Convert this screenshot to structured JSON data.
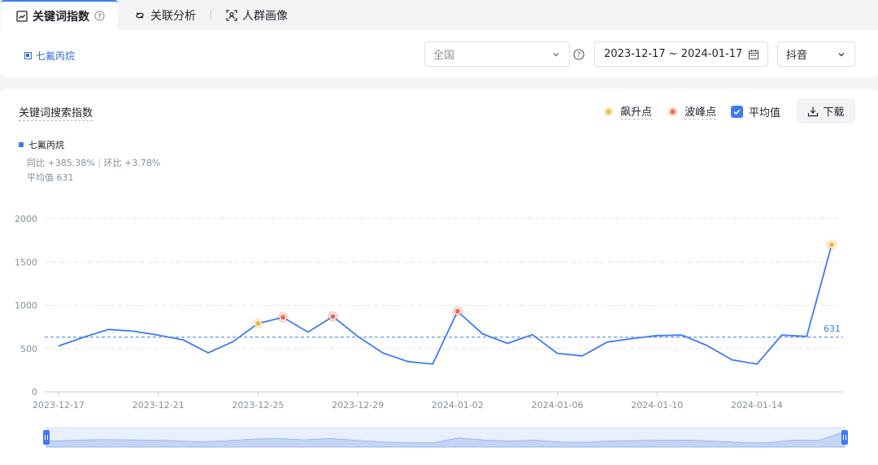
{
  "tabs": [
    {
      "label": "关键词指数",
      "icon": "trend-chart-icon",
      "active": true
    },
    {
      "label": "关联分析",
      "icon": "link-icon",
      "active": false
    },
    {
      "label": "人群画像",
      "icon": "user-scan-icon",
      "active": false
    }
  ],
  "filter": {
    "keyword": "七氟丙烷",
    "region": "全国",
    "date_range": "2023-12-17 ~ 2024-01-17",
    "platform": "抖音"
  },
  "panel": {
    "title": "关键词搜索指数",
    "legend_rise": "飙升点",
    "legend_peak": "波峰点",
    "average_label": "平均值",
    "average_checked": true,
    "download_label": "下载"
  },
  "series_info": {
    "name": "七氟丙烷",
    "compare": "同比 +385.38%｜环比 +3.78%",
    "average": "平均值 631"
  },
  "colors": {
    "accent": "#3d7bf5",
    "rise": "#f3b43a",
    "peak": "#ec6a4f"
  },
  "chart_data": {
    "type": "line",
    "ylim": [
      0,
      2000
    ],
    "yticks": [
      0,
      500,
      1000,
      1500,
      2000
    ],
    "x_tick_labels": [
      "2023-12-17",
      "2023-12-21",
      "2023-12-25",
      "2023-12-29",
      "2024-01-02",
      "2024-01-06",
      "2024-01-10",
      "2024-01-14"
    ],
    "x": [
      "2023-12-17",
      "2023-12-18",
      "2023-12-19",
      "2023-12-20",
      "2023-12-21",
      "2023-12-22",
      "2023-12-23",
      "2023-12-24",
      "2023-12-25",
      "2023-12-26",
      "2023-12-27",
      "2023-12-28",
      "2023-12-29",
      "2023-12-30",
      "2023-12-31",
      "2024-01-01",
      "2024-01-02",
      "2024-01-03",
      "2024-01-04",
      "2024-01-05",
      "2024-01-06",
      "2024-01-07",
      "2024-01-08",
      "2024-01-09",
      "2024-01-10",
      "2024-01-11",
      "2024-01-12",
      "2024-01-13",
      "2024-01-14",
      "2024-01-15",
      "2024-01-16",
      "2024-01-17"
    ],
    "series": [
      {
        "name": "七氟丙烷",
        "values": [
          530,
          630,
          720,
          700,
          655,
          600,
          450,
          580,
          790,
          860,
          690,
          870,
          640,
          450,
          350,
          320,
          930,
          670,
          560,
          660,
          445,
          415,
          575,
          615,
          650,
          655,
          535,
          370,
          320,
          655,
          640,
          1700
        ]
      }
    ],
    "average": 631,
    "average_label": "631",
    "rise_points": [
      "2023-12-25",
      "2024-01-17"
    ],
    "peak_points": [
      "2023-12-26",
      "2023-12-28",
      "2024-01-02"
    ]
  }
}
